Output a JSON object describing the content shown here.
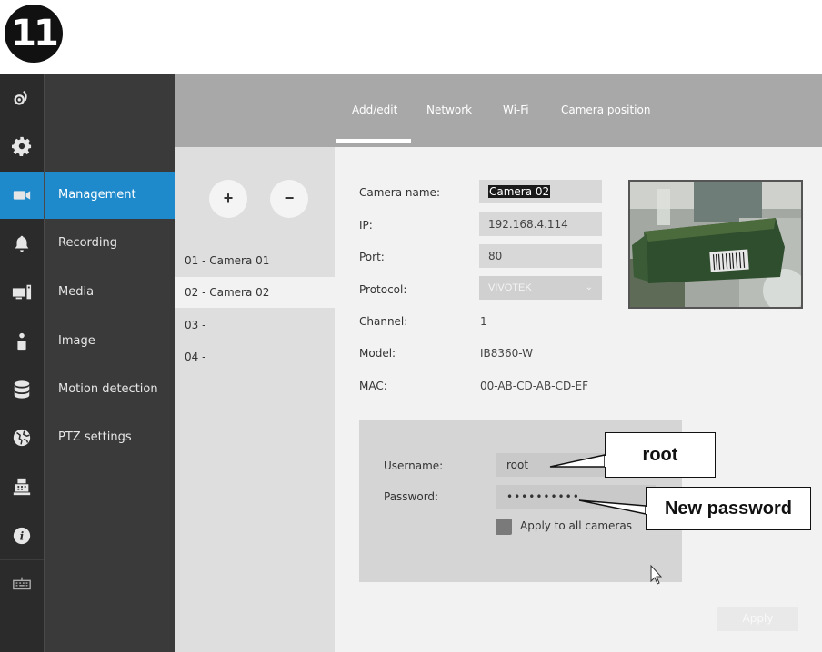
{
  "step": {
    "number": "11"
  },
  "icon_bar": {
    "items": [
      {
        "icon": "camera-lens-icon"
      },
      {
        "icon": "gear-icon"
      },
      {
        "icon": "video-camera-icon",
        "active": true
      },
      {
        "icon": "bell-icon"
      },
      {
        "icon": "monitor-speaker-icon"
      },
      {
        "icon": "person-icon"
      },
      {
        "icon": "database-icon"
      },
      {
        "icon": "globe-icon"
      },
      {
        "icon": "cash-register-icon"
      },
      {
        "icon": "info-icon"
      },
      {
        "icon": "keyboard-icon"
      }
    ]
  },
  "menu": {
    "items": [
      {
        "label": "Management",
        "active": true
      },
      {
        "label": "Recording"
      },
      {
        "label": "Media"
      },
      {
        "label": "Image"
      },
      {
        "label": "Motion detection"
      },
      {
        "label": "PTZ settings"
      }
    ]
  },
  "tabs": [
    {
      "label": "Add/edit",
      "active": true
    },
    {
      "label": "Network"
    },
    {
      "label": "Wi-Fi"
    },
    {
      "label": "Camera position"
    }
  ],
  "camera_list": {
    "add_label": "+",
    "remove_label": "−",
    "items": [
      {
        "label": "01 - Camera 01"
      },
      {
        "label": "02 - Camera 02",
        "selected": true
      },
      {
        "label": "03 -"
      },
      {
        "label": "04 -"
      }
    ]
  },
  "camera_form": {
    "camera_name_label": "Camera name:",
    "camera_name_value": "Camera 02",
    "ip_label": "IP:",
    "ip_value": "192.168.4.114",
    "port_label": "Port:",
    "port_value": "80",
    "protocol_label": "Protocol:",
    "protocol_value": "VIVOTEK",
    "channel_label": "Channel:",
    "channel_value": "1",
    "model_label": "Model:",
    "model_value": "IB8360-W",
    "mac_label": "MAC:",
    "mac_value": "00-AB-CD-AB-CD-EF"
  },
  "auth": {
    "username_label": "Username:",
    "username_value": "root",
    "password_label": "Password:",
    "password_value": "••••••••••",
    "apply_all_label": "Apply to all cameras"
  },
  "apply_label": "Apply",
  "callouts": {
    "root": "root",
    "new_password": "New password"
  },
  "colors": {
    "accent": "#1f8acb",
    "sidebar_dark": "#2b2b2b",
    "menu_dark": "#3a3a3a",
    "tab_bar": "#a8a8a8"
  }
}
